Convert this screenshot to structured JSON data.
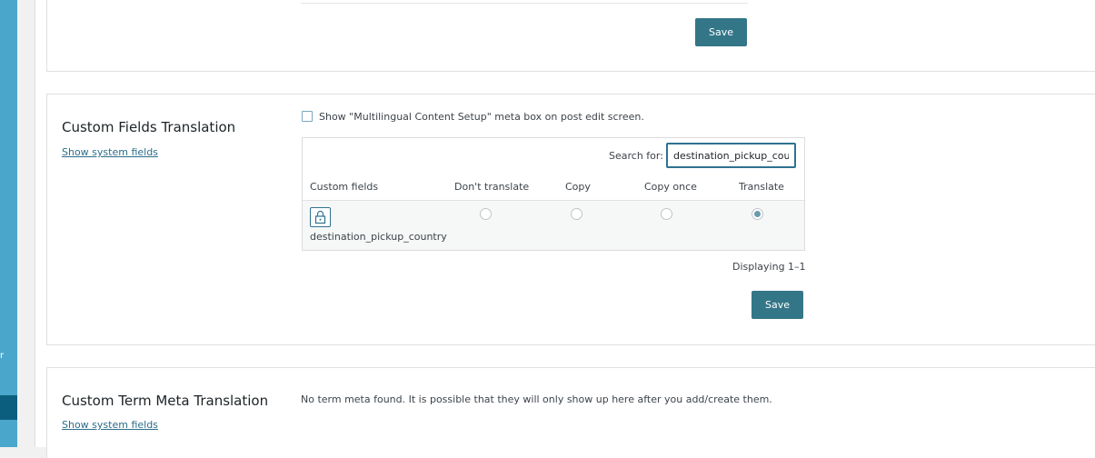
{
  "colors": {
    "sidebar": "#4aa6cb",
    "sidebar_active": "#0b5e7d",
    "button": "#337688",
    "link": "#2c6e8a",
    "radio_selected": "#6a9cae"
  },
  "sidebar": {
    "partial_text": "r"
  },
  "top_section": {
    "save_label": "Save"
  },
  "custom_fields": {
    "title": "Custom Fields Translation",
    "show_system_fields": "Show system fields",
    "meta_box_checkbox_label": "Show \"Multilingual Content Setup\" meta box on post edit screen.",
    "meta_box_checked": false,
    "search_label": "Search for:",
    "search_value": "destination_pickup_count",
    "columns": [
      "Custom fields",
      "Don't translate",
      "Copy",
      "Copy once",
      "Translate"
    ],
    "rows": [
      {
        "field": "destination_pickup_country",
        "icon": "lock-icon",
        "selected": "Translate"
      }
    ],
    "displaying": "Displaying 1–1",
    "save_label": "Save"
  },
  "term_meta": {
    "title": "Custom Term Meta Translation",
    "show_system_fields": "Show system fields",
    "message": "No term meta found. It is possible that they will only show up here after you add/create them."
  }
}
